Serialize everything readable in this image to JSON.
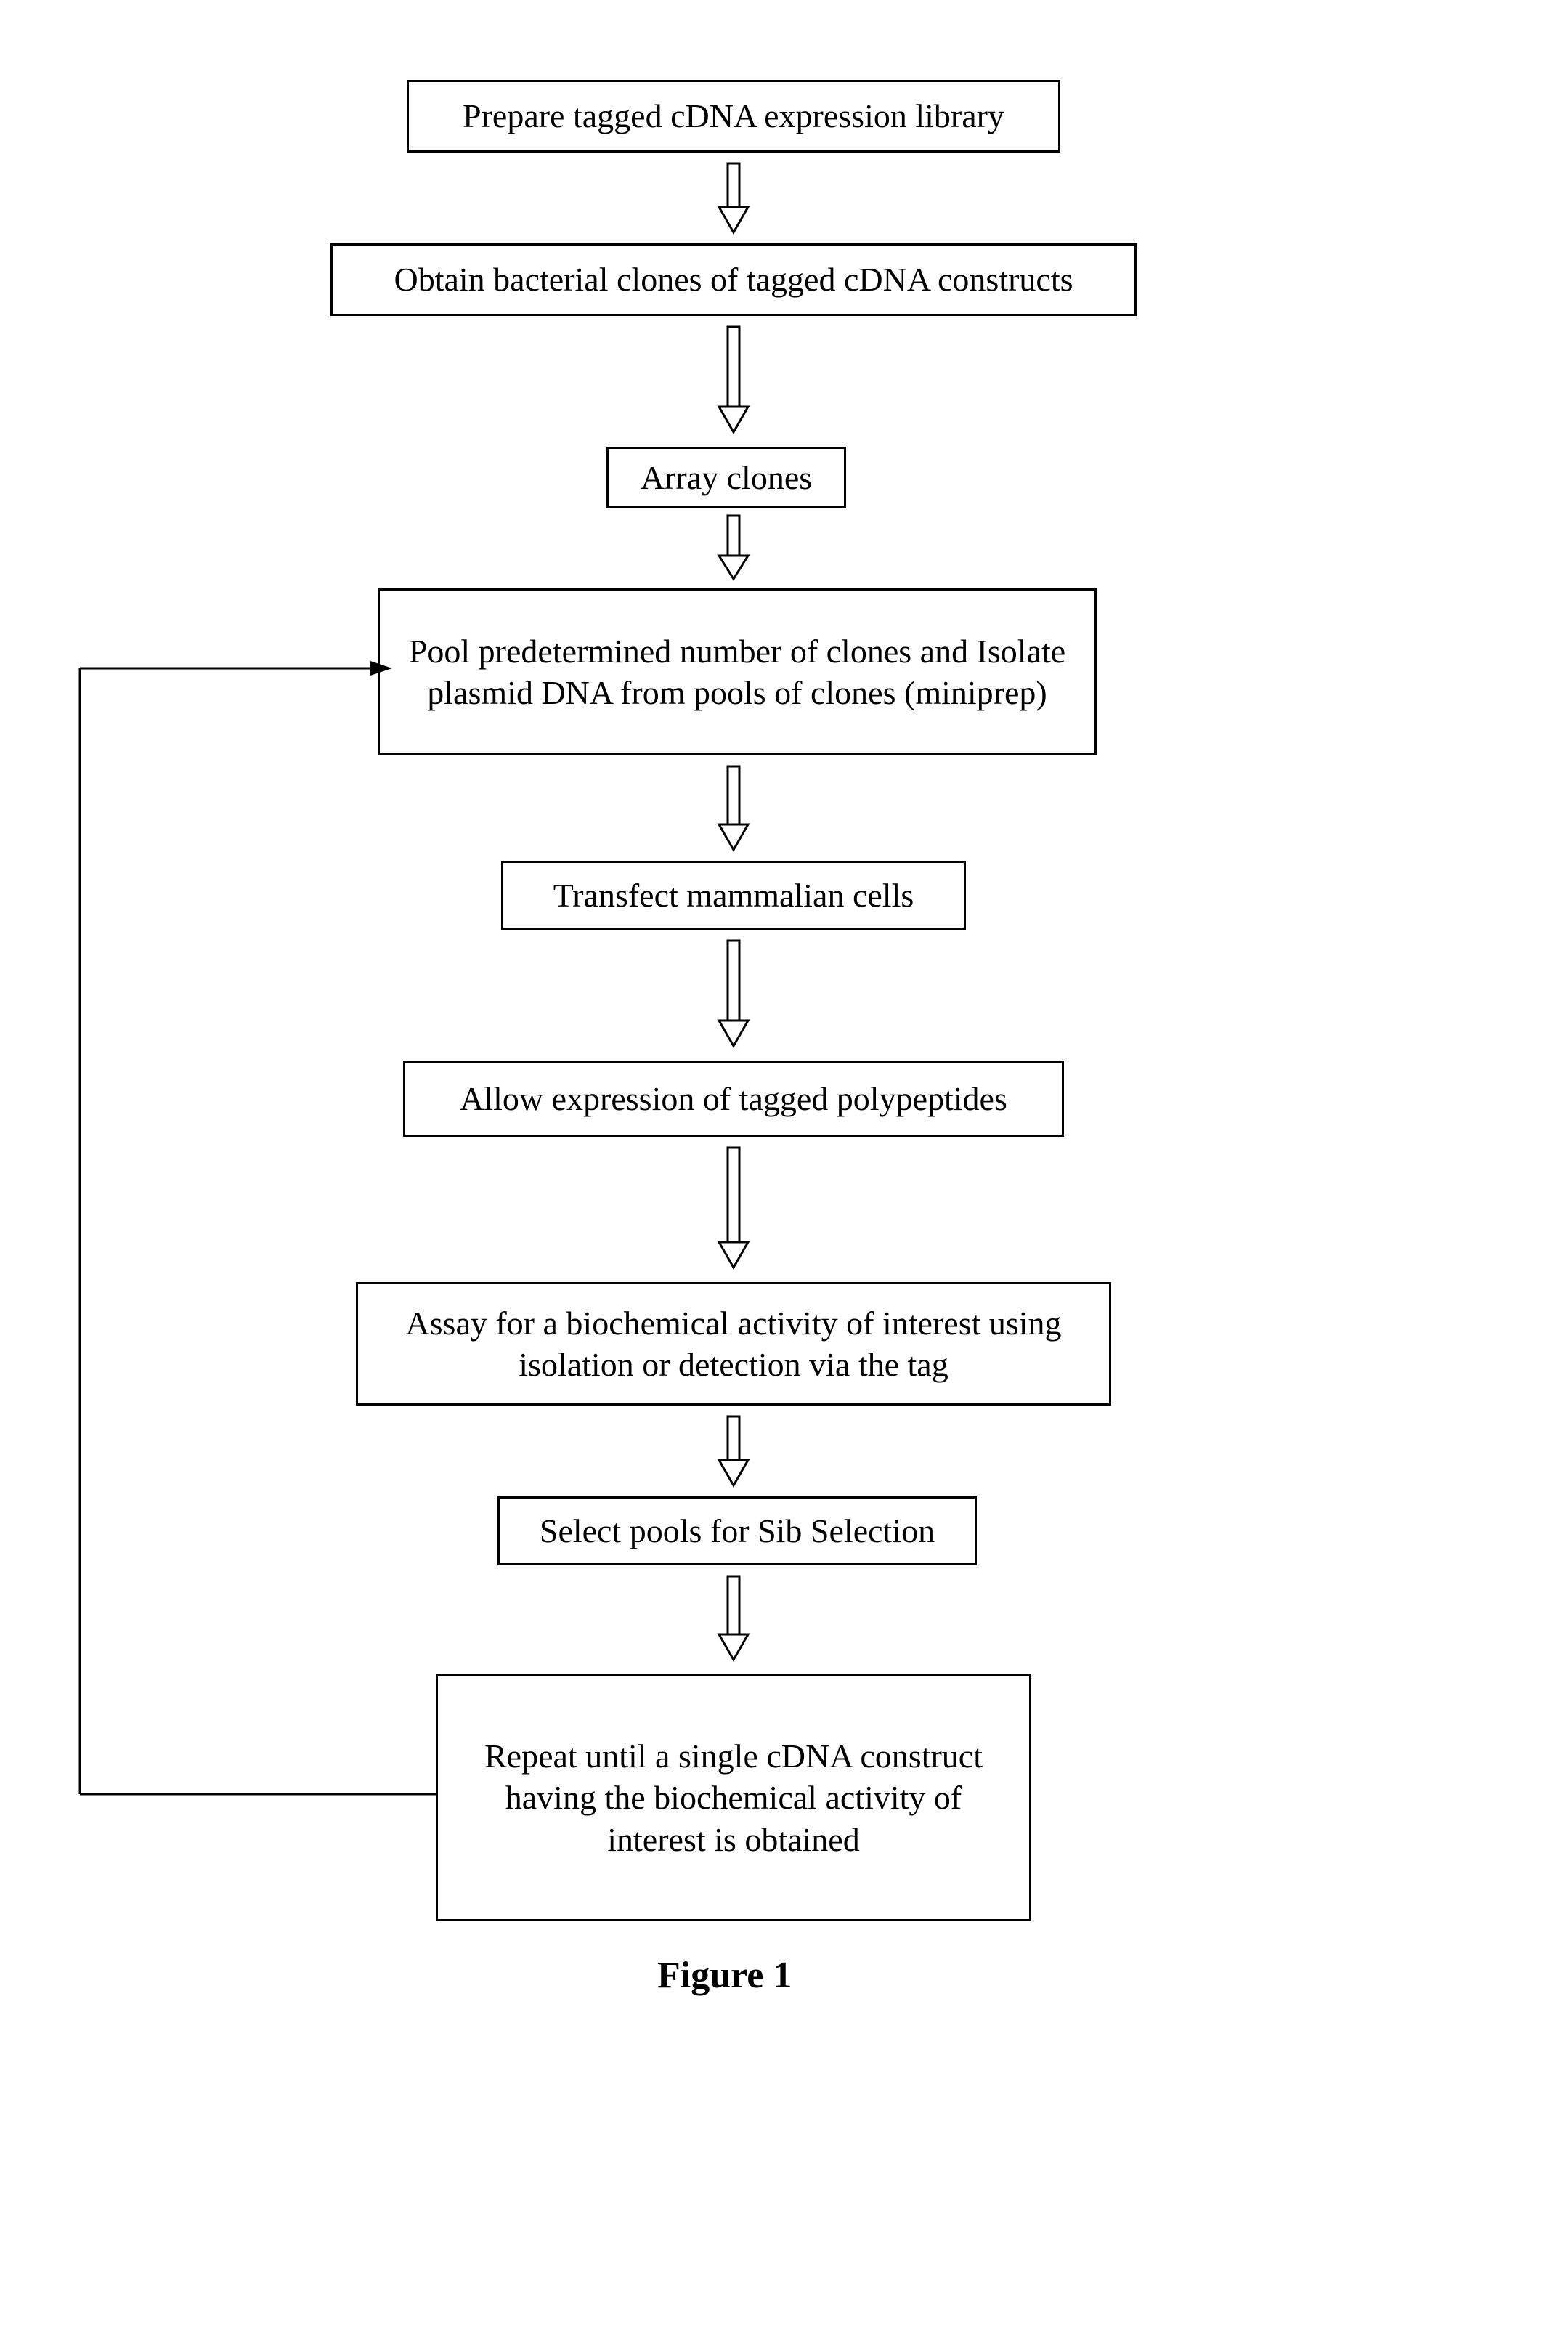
{
  "flowchart": {
    "boxes": [
      {
        "id": "b1",
        "text": "Prepare tagged cDNA expression library"
      },
      {
        "id": "b2",
        "text": "Obtain bacterial clones of tagged cDNA constructs"
      },
      {
        "id": "b3",
        "text": "Array clones"
      },
      {
        "id": "b4",
        "text": "Pool predetermined number of clones and Isolate plasmid DNA from pools of clones (miniprep)"
      },
      {
        "id": "b5",
        "text": "Transfect mammalian cells"
      },
      {
        "id": "b6",
        "text": "Allow expression of tagged polypeptides"
      },
      {
        "id": "b7",
        "text": "Assay for a biochemical activity of interest using isolation or detection via the tag"
      },
      {
        "id": "b8",
        "text": "Select pools for Sib Selection"
      },
      {
        "id": "b9",
        "text": "Repeat until a single cDNA construct having the biochemical activity of interest is obtained"
      }
    ],
    "caption": "Figure 1"
  }
}
